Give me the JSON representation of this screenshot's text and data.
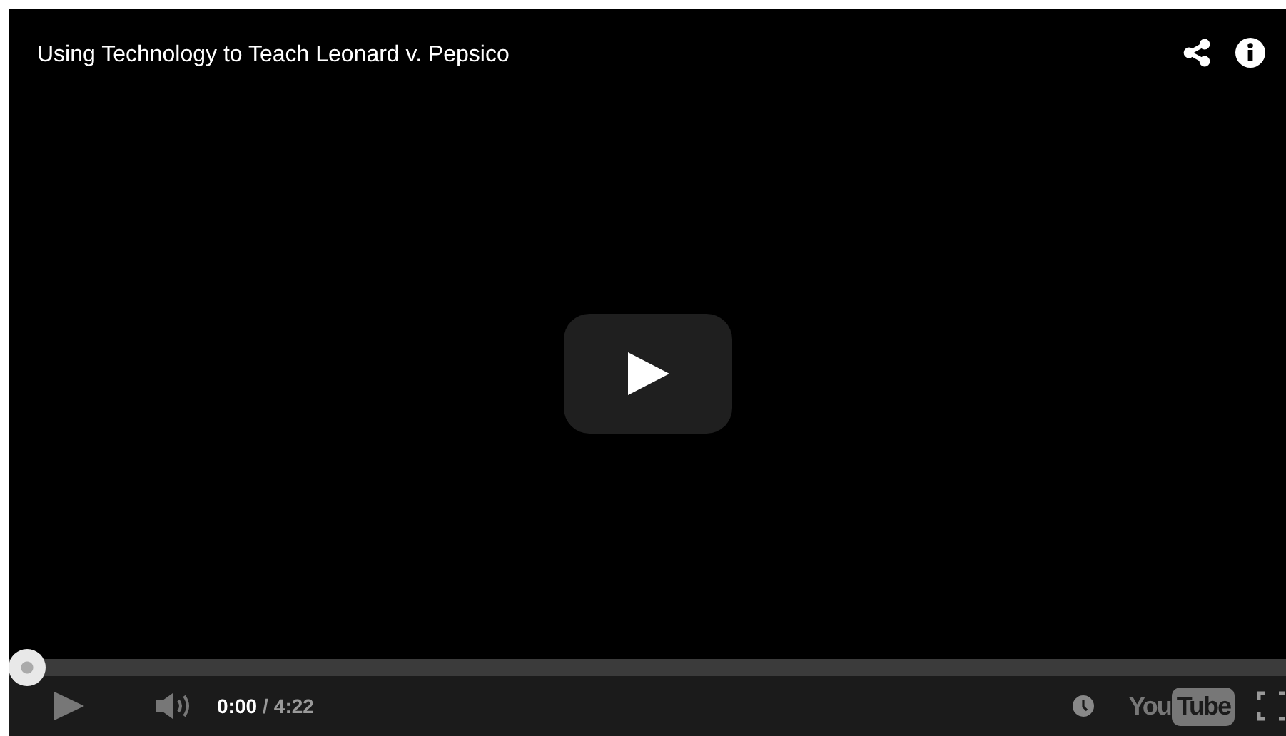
{
  "video": {
    "title": "Using Technology to Teach Leonard v. Pepsico"
  },
  "progress": {
    "level": 0
  },
  "controls": {
    "current_time": "0:00",
    "separator": "/",
    "duration": "4:22"
  },
  "logo": {
    "part_1": "You",
    "part_2": "Tube"
  }
}
